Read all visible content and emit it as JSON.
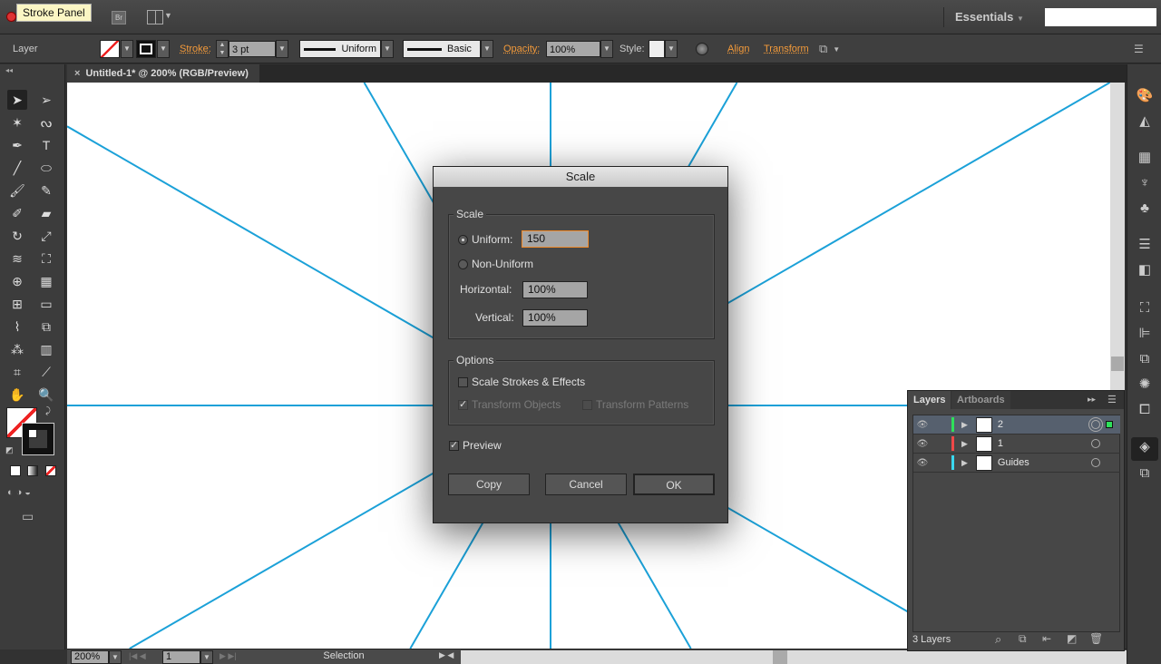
{
  "app_bar": {
    "tooltip": "Stroke Panel",
    "bridge_label": "Br",
    "workspace": "Essentials",
    "search_placeholder": ""
  },
  "control_bar": {
    "selection_label": "Layer",
    "stroke_label": "Stroke:",
    "stroke_weight": "3 pt",
    "variable_width": "Uniform",
    "brush": "Basic",
    "opacity_label": "Opacity:",
    "opacity": "100%",
    "style_label": "Style:",
    "align_label": "Align",
    "transform_label": "Transform"
  },
  "document": {
    "tab_title": "Untitled-1* @ 200% (RGB/Preview)",
    "guide_color": "#1ba1d8"
  },
  "status_bar": {
    "zoom": "200%",
    "artboard": "1",
    "tool": "Selection"
  },
  "dialog": {
    "title": "Scale",
    "scale_group": "Scale",
    "uniform_label": "Uniform:",
    "uniform_value": "150",
    "non_uniform_label": "Non-Uniform",
    "horizontal_label": "Horizontal:",
    "horizontal_value": "100%",
    "vertical_label": "Vertical:",
    "vertical_value": "100%",
    "mode": "uniform",
    "options_group": "Options",
    "scale_strokes_label": "Scale Strokes & Effects",
    "scale_strokes_checked": false,
    "transform_objects_label": "Transform Objects",
    "transform_objects_checked": true,
    "transform_patterns_label": "Transform Patterns",
    "transform_patterns_checked": false,
    "preview_label": "Preview",
    "preview_checked": true,
    "copy_label": "Copy",
    "cancel_label": "Cancel",
    "ok_label": "OK"
  },
  "layers_panel": {
    "tabs": [
      "Layers",
      "Artboards"
    ],
    "count_label": "3 Layers",
    "layers": [
      {
        "name": "2",
        "color": "#2ee05a",
        "selected": true
      },
      {
        "name": "1",
        "color": "#f04848",
        "selected": false
      },
      {
        "name": "Guides",
        "color": "#3ad8f0",
        "selected": false
      }
    ]
  }
}
